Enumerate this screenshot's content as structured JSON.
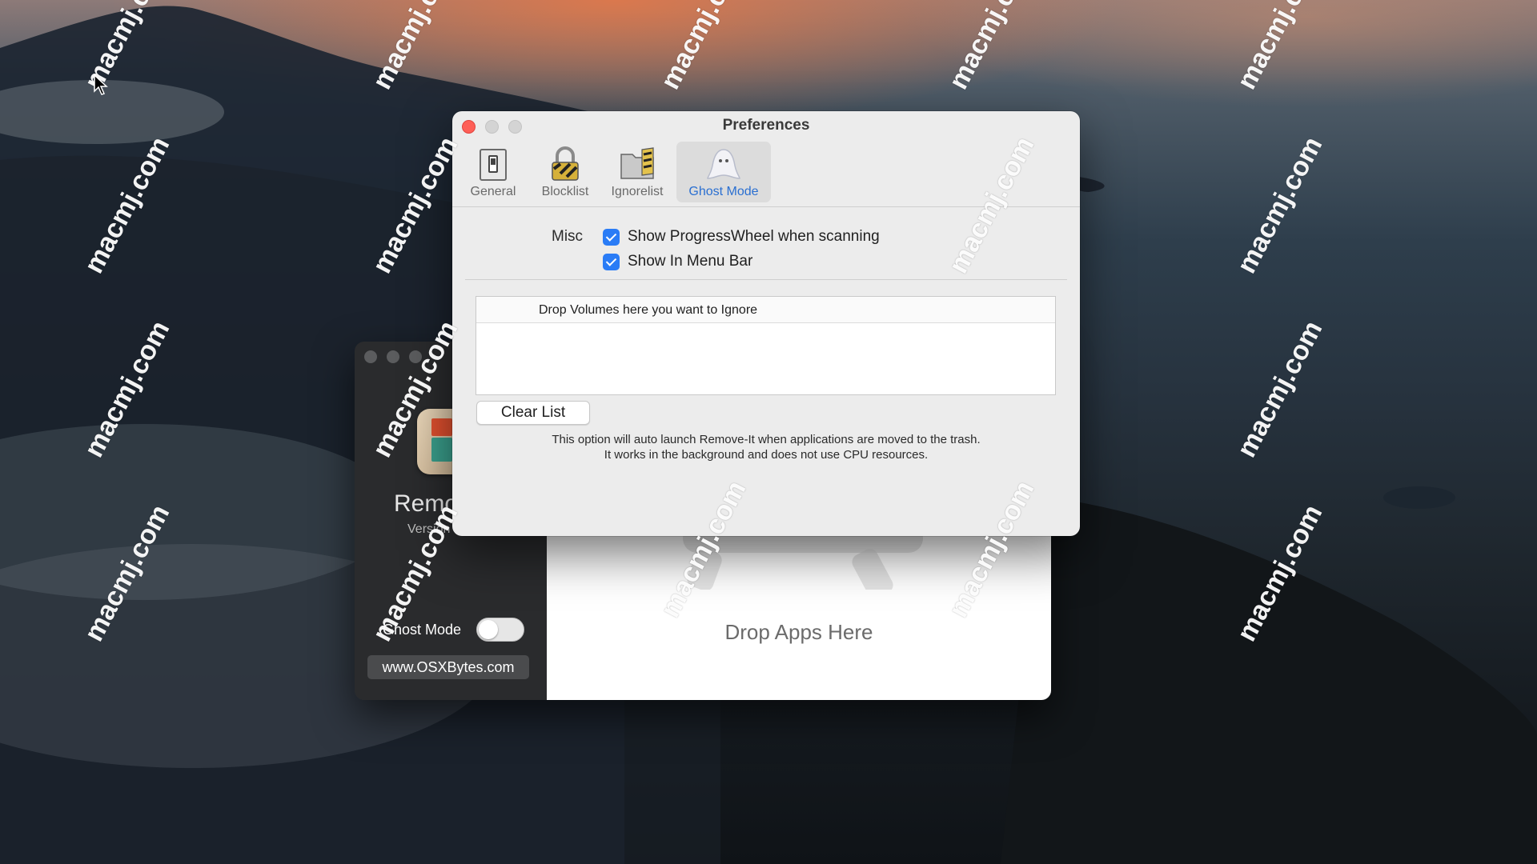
{
  "watermark_text": "macmj.com",
  "preferences": {
    "title": "Preferences",
    "tabs": [
      {
        "label": "General",
        "icon": "switch-icon"
      },
      {
        "label": "Blocklist",
        "icon": "padlock-icon"
      },
      {
        "label": "Ignorelist",
        "icon": "folder-icon"
      },
      {
        "label": "Ghost Mode",
        "icon": "ghost-icon",
        "active": true
      }
    ],
    "misc_label": "Misc",
    "options": [
      {
        "label": "Show ProgressWheel when scanning",
        "checked": true
      },
      {
        "label": "Show In Menu Bar",
        "checked": true
      }
    ],
    "drop_table_header": "Drop Volumes here you want to Ignore",
    "clear_button": "Clear List",
    "note_line1": "This option will auto launch Remove-It when applications are moved to the trash.",
    "note_line2": "It works in the background and does not use CPU resources."
  },
  "app_window": {
    "app_name": "Remo",
    "version_label": "Version",
    "ghost_mode_label": "Ghost Mode",
    "ghost_mode_on": false,
    "website_button": "www.OSXBytes.com",
    "drop_label": "Drop Apps Here"
  },
  "colors": {
    "accent": "#2a7cf6",
    "close": "#fe5f57",
    "active_tab_text": "#2a6fd1"
  }
}
